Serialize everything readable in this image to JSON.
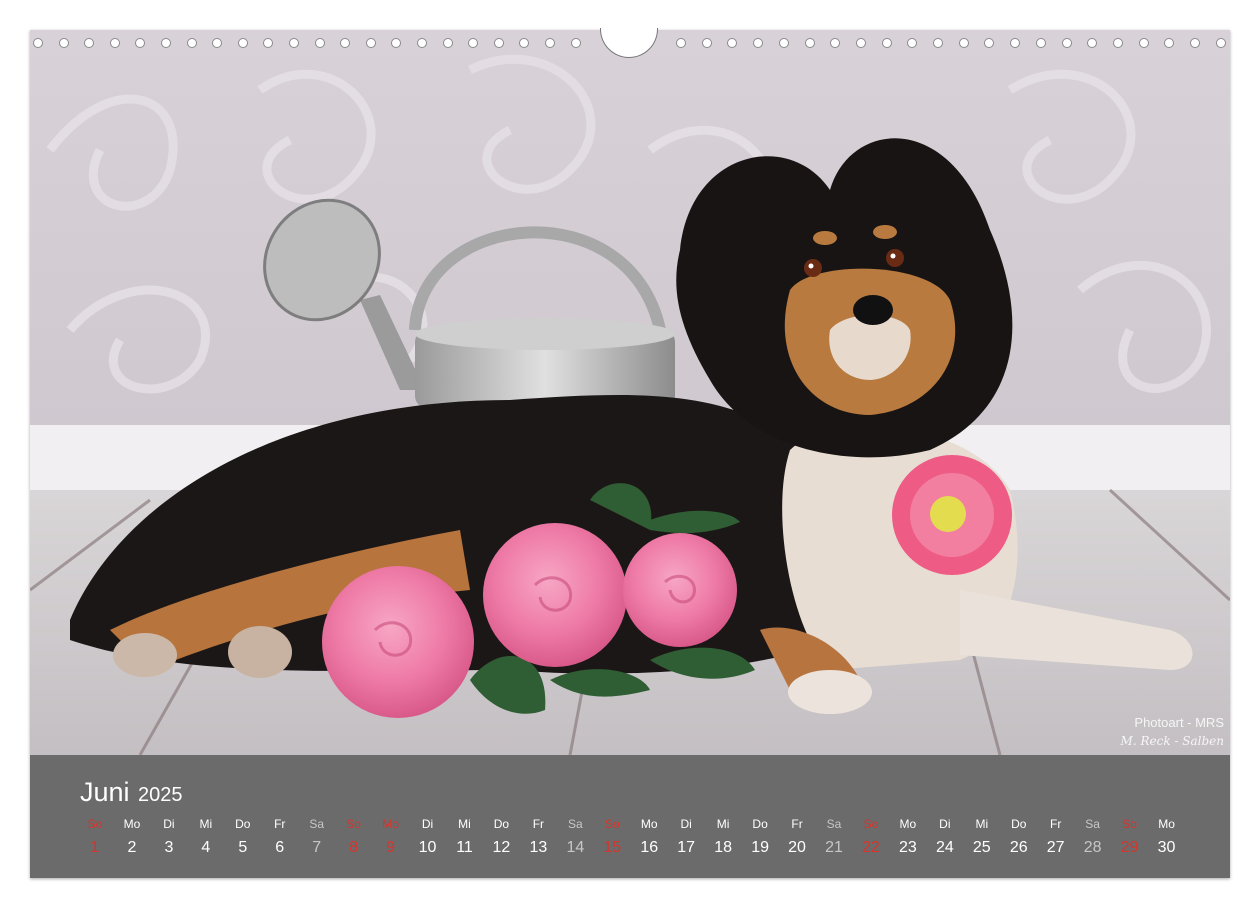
{
  "calendar": {
    "month": "Juni",
    "year": "2025",
    "day_headers": [
      "So",
      "Mo",
      "Di",
      "Mi",
      "Do",
      "Fr",
      "Sa",
      "So",
      "Mo",
      "Di",
      "Mi",
      "Do",
      "Fr",
      "Sa",
      "So",
      "Mo",
      "Di",
      "Mi",
      "Do",
      "Fr",
      "Sa",
      "So",
      "Mo",
      "Di",
      "Mi",
      "Do",
      "Fr",
      "Sa",
      "So",
      "Mo"
    ],
    "dates": [
      "1",
      "2",
      "3",
      "4",
      "5",
      "6",
      "7",
      "8",
      "9",
      "10",
      "11",
      "12",
      "13",
      "14",
      "15",
      "16",
      "17",
      "18",
      "19",
      "20",
      "21",
      "22",
      "23",
      "24",
      "25",
      "26",
      "27",
      "28",
      "29",
      "30"
    ],
    "day_types": [
      "sun",
      "wd",
      "wd",
      "wd",
      "wd",
      "wd",
      "sat",
      "sun",
      "sun",
      "wd",
      "wd",
      "wd",
      "wd",
      "sat",
      "sun",
      "wd",
      "wd",
      "wd",
      "wd",
      "wd",
      "sat",
      "sun",
      "wd",
      "wd",
      "wd",
      "wd",
      "wd",
      "sat",
      "sun",
      "wd"
    ]
  },
  "photo": {
    "watermark_line1": "Photoart - MRS",
    "watermark_line2": "M. Reck - Salben"
  },
  "colors": {
    "date_bar": "#6b6b6b",
    "sunday_red": "#d9342b",
    "saturday_grey": "#c7c7c7"
  }
}
